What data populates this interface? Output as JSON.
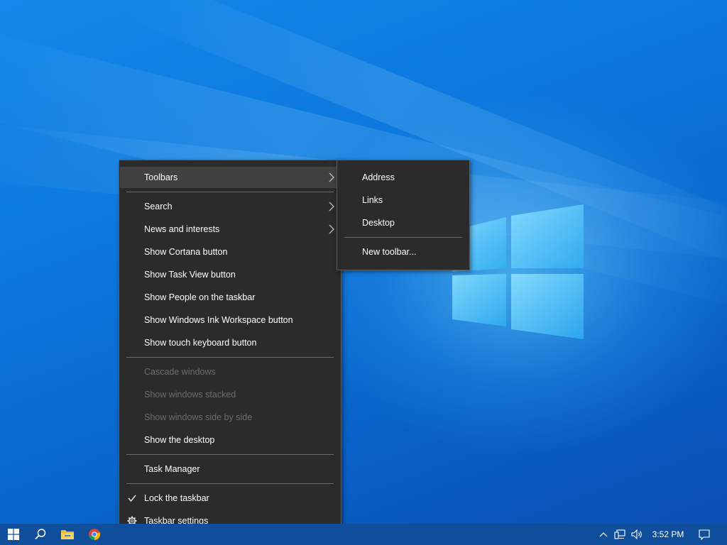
{
  "context_menu": {
    "items": [
      {
        "label": "Toolbars"
      },
      {
        "label": "Search"
      },
      {
        "label": "News and interests"
      },
      {
        "label": "Show Cortana button"
      },
      {
        "label": "Show Task View button"
      },
      {
        "label": "Show People on the taskbar"
      },
      {
        "label": "Show Windows Ink Workspace button"
      },
      {
        "label": "Show touch keyboard button"
      },
      {
        "label": "Cascade windows"
      },
      {
        "label": "Show windows stacked"
      },
      {
        "label": "Show windows side by side"
      },
      {
        "label": "Show the desktop"
      },
      {
        "label": "Task Manager"
      },
      {
        "label": "Lock the taskbar"
      },
      {
        "label": "Taskbar settings"
      }
    ]
  },
  "toolbars_submenu": {
    "items": [
      {
        "label": "Address"
      },
      {
        "label": "Links"
      },
      {
        "label": "Desktop"
      },
      {
        "label": "New toolbar..."
      }
    ]
  },
  "taskbar": {
    "clock": "3:52 PM"
  },
  "colors": {
    "menu_bg": "#2b2b2b",
    "menu_hover": "#414141",
    "taskbar": "#0e4e9a",
    "desktop": "#0b78dd"
  }
}
